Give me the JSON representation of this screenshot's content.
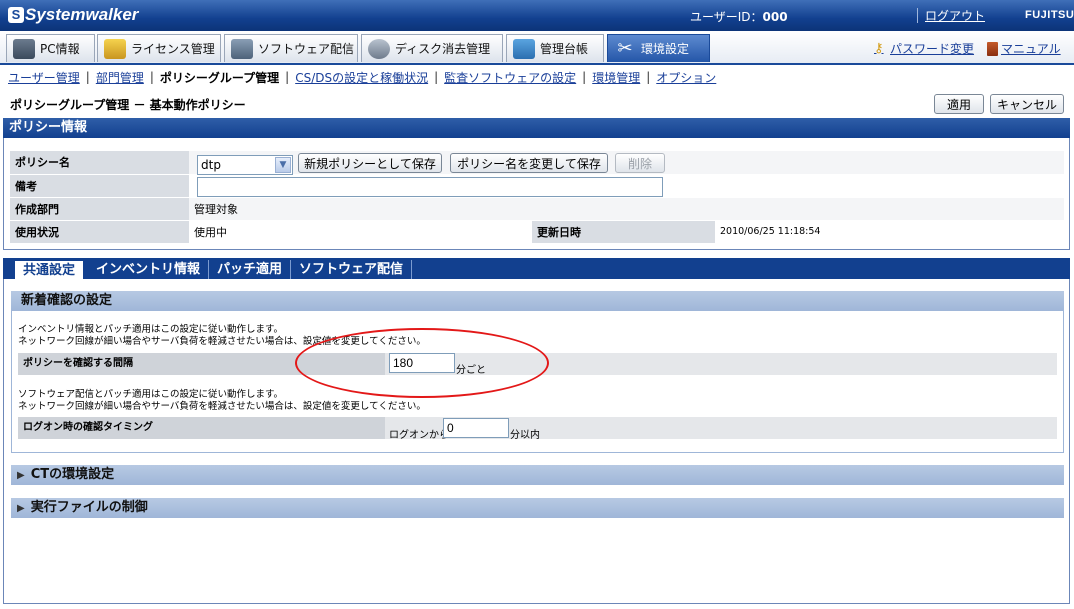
{
  "header": {
    "logo_text": "Systemwalker",
    "userid_label": "ユーザーID：",
    "userid_value": "000",
    "logout": "ログアウト",
    "vendor": "FUJITSU"
  },
  "main_tabs": [
    {
      "label": "PC情報"
    },
    {
      "label": "ライセンス管理"
    },
    {
      "label": "ソフトウェア配信"
    },
    {
      "label": "ディスク消去管理"
    },
    {
      "label": "管理台帳"
    },
    {
      "label": "環境設定"
    }
  ],
  "top_links": {
    "password": "パスワード変更",
    "manual": "マニュアル"
  },
  "subnav": [
    {
      "label": "ユーザー管理"
    },
    {
      "label": "部門管理"
    },
    {
      "label": "ポリシーグループ管理"
    },
    {
      "label": "CS/DSの設定と稼働状況"
    },
    {
      "label": "監査ソフトウェアの設定"
    },
    {
      "label": "環境管理"
    },
    {
      "label": "オプション"
    }
  ],
  "page": {
    "title": "ポリシーグループ管理 － 基本動作ポリシー",
    "apply": "適用",
    "cancel": "キャンセル"
  },
  "policy_info": {
    "section_title": "ポリシー情報",
    "name_label": "ポリシー名",
    "name_value": "dtp",
    "save_new": "新規ポリシーとして保存",
    "rename_save": "ポリシー名を変更して保存",
    "delete": "削除",
    "remarks_label": "備考",
    "remarks_value": "",
    "dept_label": "作成部門",
    "dept_value": "管理対象",
    "status_label": "使用状況",
    "status_value": "使用中",
    "updated_label": "更新日時",
    "updated_value": "2010/06/25 11:18:54"
  },
  "sub_tabs": [
    {
      "label": "共通設定"
    },
    {
      "label": "インベントリ情報"
    },
    {
      "label": "パッチ適用"
    },
    {
      "label": "ソフトウェア配信"
    }
  ],
  "new_arrival": {
    "title": "新着確認の設定",
    "note1_line1": "インベントリ情報とパッチ適用はこの設定に従い動作します。",
    "note1_line2": "ネットワーク回線が細い場合やサーバ負荷を軽減させたい場合は、設定値を変更してください。",
    "interval_label": "ポリシーを確認する間隔",
    "interval_value": "180",
    "interval_unit": "分ごと",
    "note2_line1": "ソフトウェア配信とパッチ適用はこの設定に従い動作します。",
    "note2_line2": "ネットワーク回線が細い場合やサーバ負荷を軽減させたい場合は、設定値を変更してください。",
    "logon_label": "ログオン時の確認タイミング",
    "logon_prefix": "ログオンから",
    "logon_value": "0",
    "logon_unit": "分以内"
  },
  "groups": {
    "ct": "CTの環境設定",
    "exec": "実行ファイルの制御"
  },
  "colors": {
    "header_blue": "#12408f",
    "link_blue": "#1a3f99",
    "highlight_red": "#e31818"
  }
}
